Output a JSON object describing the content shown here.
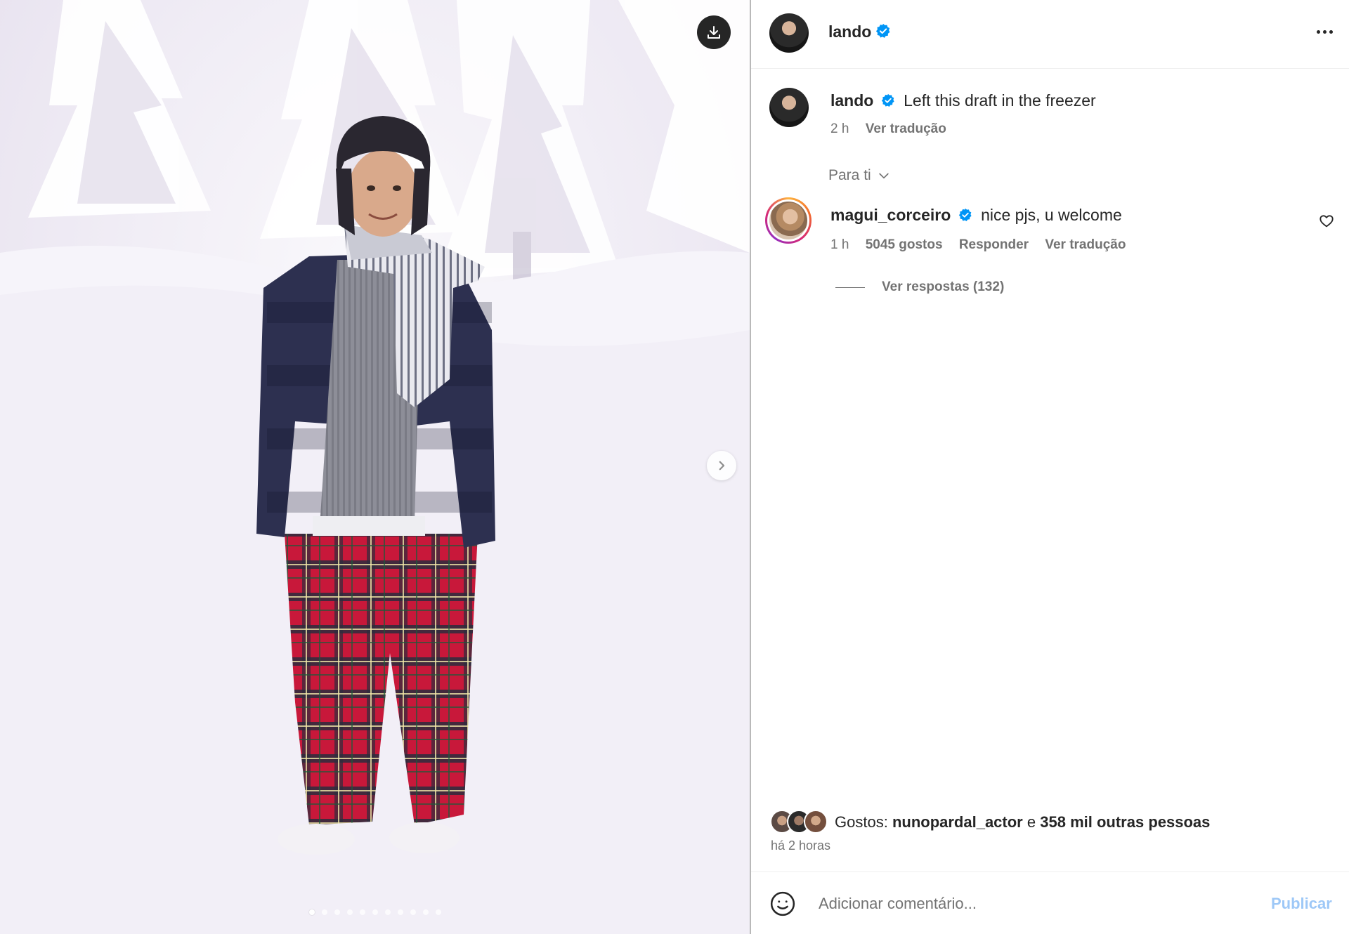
{
  "post": {
    "author": "lando",
    "caption": "Left this draft in the freezer",
    "caption_age": "2 h",
    "translate_label": "Ver tradução",
    "carousel_count": 11,
    "carousel_active": 1
  },
  "media": {
    "download_icon": "download-icon",
    "next_icon": "chevron-right-icon"
  },
  "header": {
    "more_icon": "more-horizontal-icon"
  },
  "sort": {
    "label": "Para ti",
    "icon": "chevron-down-icon"
  },
  "comments": [
    {
      "username": "magui_corceiro",
      "text": "nice pjs, u welcome",
      "age": "1 h",
      "likes": "5045 gostos",
      "reply_label": "Responder",
      "translate_label": "Ver tradução",
      "replies_label": "Ver respostas (132)"
    }
  ],
  "likes": {
    "prefix": "Gostos:",
    "user": "nunopardal_actor",
    "joiner": "e",
    "others": "358 mil outras pessoas",
    "time": "há 2 horas"
  },
  "composer": {
    "placeholder": "Adicionar comentário...",
    "post_label": "Publicar",
    "emoji_icon": "emoji-icon"
  },
  "colors": {
    "verified": "#0095f6",
    "post_disabled": "#9ec8f7",
    "muted_text": "#737373",
    "primary_text": "#262626"
  }
}
